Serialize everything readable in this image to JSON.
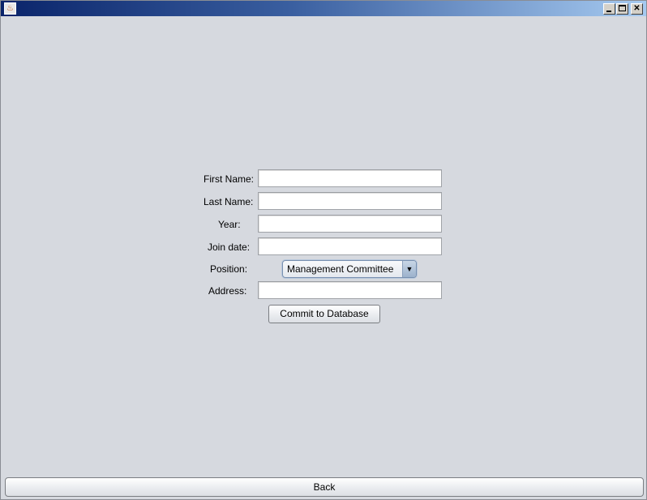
{
  "window": {
    "title": "",
    "app_icon": "java-cup-icon",
    "controls": {
      "minimize": "minimize-icon",
      "maximize": "maximize-icon",
      "close_label": "✕"
    }
  },
  "form": {
    "fields": [
      {
        "label": "First Name:",
        "value": ""
      },
      {
        "label": "Last Name:",
        "value": ""
      },
      {
        "label": "Year:",
        "value": ""
      },
      {
        "label": "Join date:",
        "value": ""
      }
    ],
    "position": {
      "label": "Position:",
      "selected": "Management Committee",
      "arrow": "▼"
    },
    "address": {
      "label": "Address:",
      "value": ""
    },
    "commit_label": "Commit to Database"
  },
  "footer": {
    "back_label": "Back"
  }
}
